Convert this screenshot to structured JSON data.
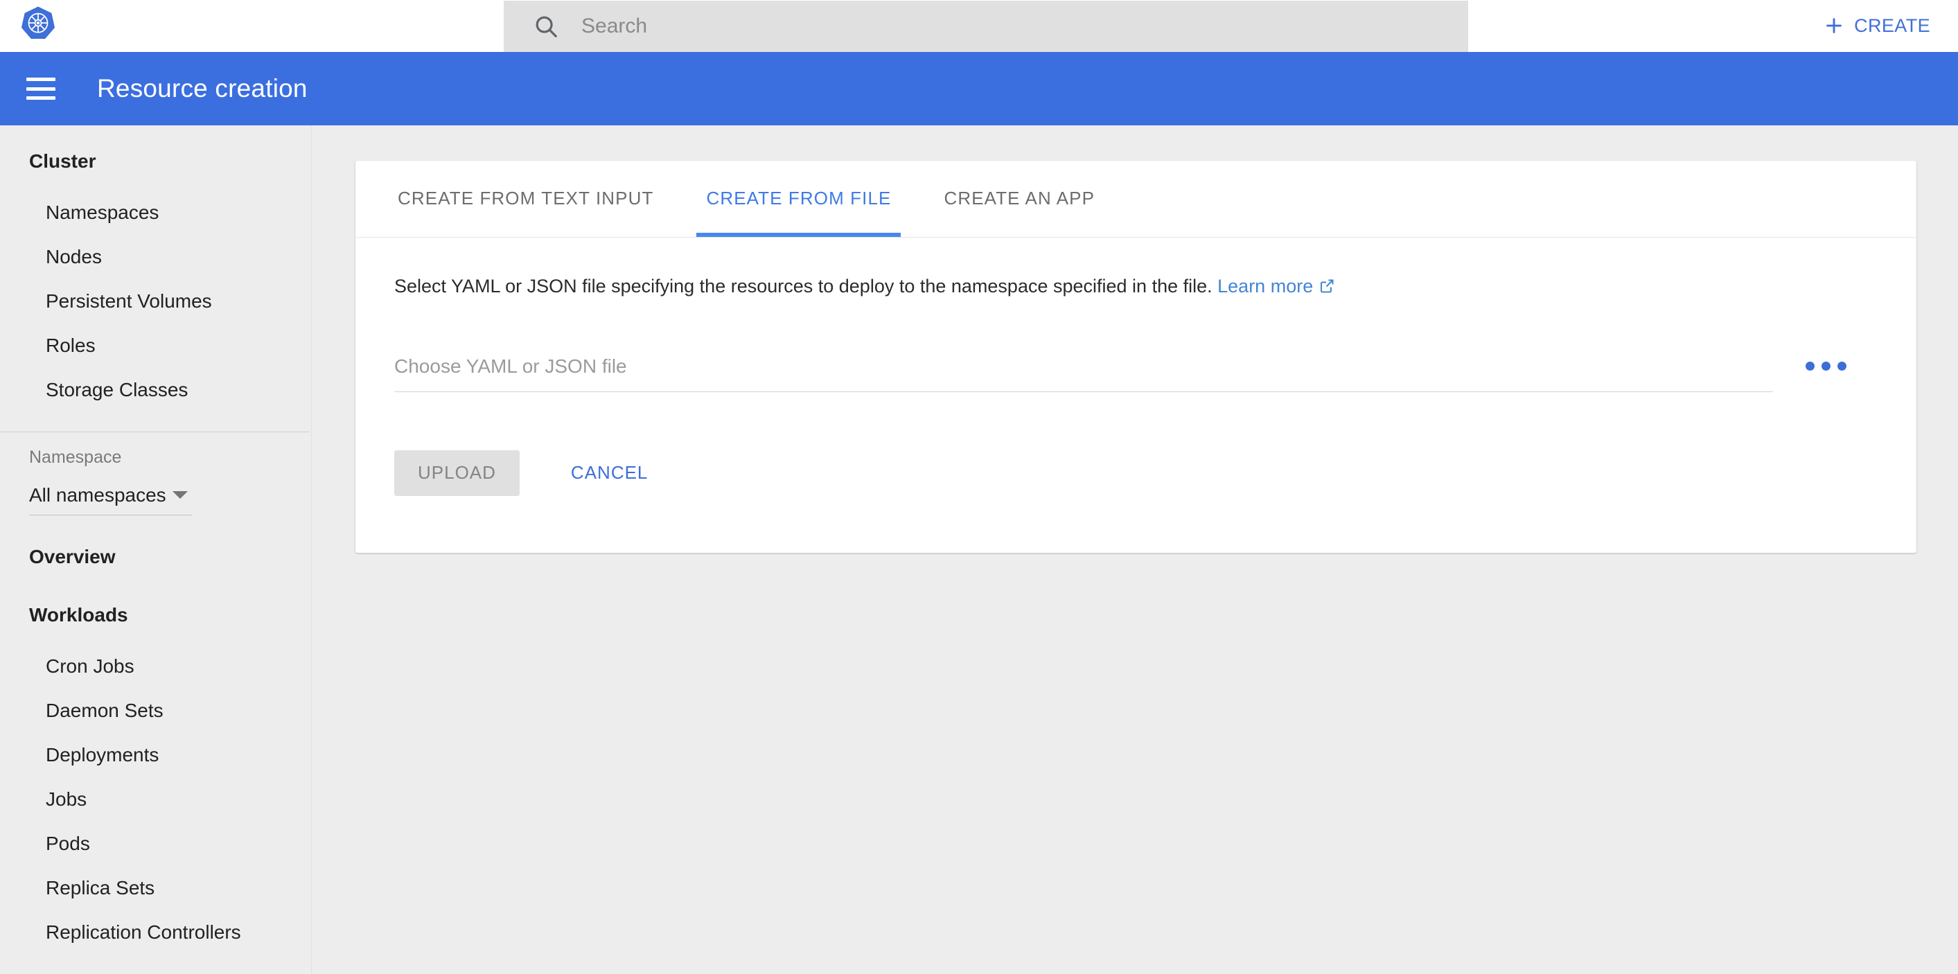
{
  "topbar": {
    "logo_name": "kubernetes-logo",
    "search": {
      "placeholder": "Search",
      "value": "",
      "icon": "search-icon"
    },
    "create_button": {
      "label": "CREATE",
      "icon": "plus-icon",
      "color": "#3f6fd8"
    }
  },
  "header": {
    "title": "Resource creation",
    "menu_icon": "hamburger-menu-icon",
    "background": "#3b6fe0"
  },
  "sidebar": {
    "cluster": {
      "title": "Cluster",
      "items": [
        {
          "label": "Namespaces"
        },
        {
          "label": "Nodes"
        },
        {
          "label": "Persistent Volumes"
        },
        {
          "label": "Roles"
        },
        {
          "label": "Storage Classes"
        }
      ]
    },
    "namespace": {
      "label": "Namespace",
      "selected": "All namespaces",
      "caret_icon": "chevron-down-icon"
    },
    "overview": {
      "title": "Overview"
    },
    "workloads": {
      "title": "Workloads",
      "items": [
        {
          "label": "Cron Jobs"
        },
        {
          "label": "Daemon Sets"
        },
        {
          "label": "Deployments"
        },
        {
          "label": "Jobs"
        },
        {
          "label": "Pods"
        },
        {
          "label": "Replica Sets"
        },
        {
          "label": "Replication Controllers"
        }
      ]
    }
  },
  "main": {
    "tabs": [
      {
        "label": "CREATE FROM TEXT INPUT",
        "active": false
      },
      {
        "label": "CREATE FROM FILE",
        "active": true
      },
      {
        "label": "CREATE AN APP",
        "active": false
      }
    ],
    "description": {
      "text": "Select YAML or JSON file specifying the resources to deploy to the namespace specified in the file.",
      "link_label": "Learn more",
      "link_icon": "external-link-icon"
    },
    "file_field": {
      "placeholder": "Choose YAML or JSON file",
      "value": "",
      "browse_icon": "more-dots-icon"
    },
    "buttons": {
      "upload_label": "UPLOAD",
      "cancel_label": "CANCEL"
    },
    "accent_color": "#4788ec"
  }
}
